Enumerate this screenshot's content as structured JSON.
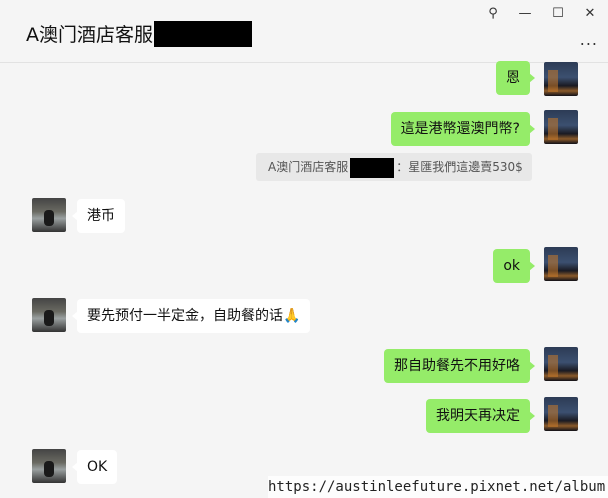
{
  "window": {
    "title": "A澳门酒店客服",
    "controls": {
      "pin": "⚲",
      "minimize": "—",
      "maximize": "☐",
      "close": "✕"
    },
    "more_label": "..."
  },
  "messages": [
    {
      "from": "me",
      "text": "恩"
    },
    {
      "from": "me",
      "text": "這是港幣還澳門幣?"
    },
    {
      "from": "quote",
      "sender": "A澳门酒店客服",
      "text": "：星匯我們這邊賣530$"
    },
    {
      "from": "other",
      "text": "港币"
    },
    {
      "from": "me",
      "text": "ok"
    },
    {
      "from": "other",
      "text": "要先预付一半定金，自助餐的话🙏"
    },
    {
      "from": "me",
      "text": "那自助餐先不用好咯"
    },
    {
      "from": "me",
      "text": "我明天再决定"
    },
    {
      "from": "other",
      "text": "OK"
    }
  ],
  "watermark": "https://austinleefuture.pixnet.net/album"
}
